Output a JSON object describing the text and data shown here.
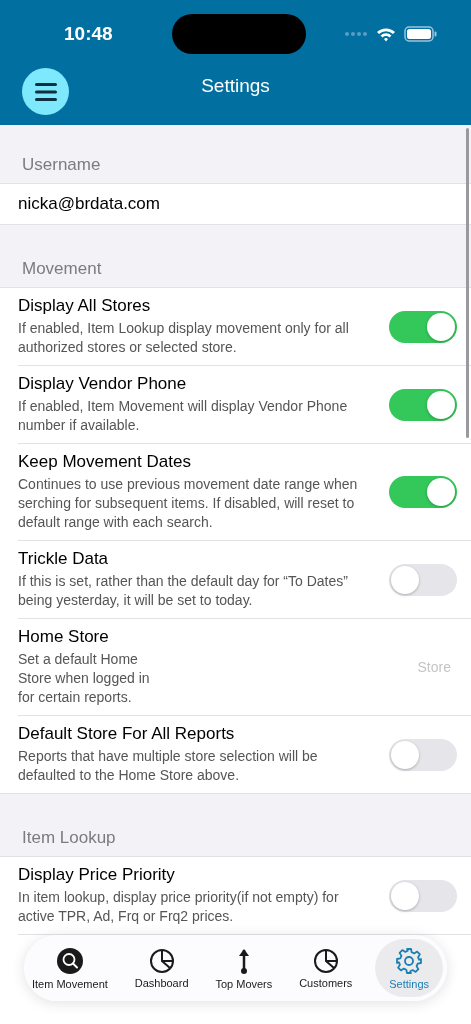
{
  "status_bar": {
    "time": "10:48"
  },
  "nav": {
    "title": "Settings"
  },
  "sections": [
    {
      "header": "Username",
      "rows": [
        {
          "kind": "text",
          "title": "nicka@brdata.com"
        }
      ]
    },
    {
      "header": "Movement",
      "rows": [
        {
          "kind": "toggle",
          "title": "Display All Stores",
          "description": "If enabled, Item Lookup display movement only for all authorized stores or selected store.",
          "on": true
        },
        {
          "kind": "toggle",
          "title": "Display Vendor Phone",
          "description": "If enabled, Item Movement will display Vendor Phone number if available.",
          "on": true
        },
        {
          "kind": "toggle",
          "title": "Keep Movement Dates",
          "description": "Continues to use previous movement date range when serching for subsequent items. If disabled, will reset to default range with each search.",
          "on": true
        },
        {
          "kind": "toggle",
          "title": "Trickle Data",
          "description": "If this is set, rather than the default day for “To Dates” being yesterday, it will be set to today.",
          "on": false
        },
        {
          "kind": "value",
          "title": "Home Store",
          "description": "Set a default Home Store when logged in for certain reports.",
          "placeholder": "Store"
        },
        {
          "kind": "toggle",
          "title": "Default Store For All Reports",
          "description": "Reports that have multiple store selection will be defaulted to the Home Store above.",
          "on": false
        }
      ]
    },
    {
      "header": "Item Lookup",
      "rows": [
        {
          "kind": "toggle",
          "title": "Display Price Priority",
          "description": "In item lookup, display price priority(if not empty) for active TPR, Ad, Frq or Frq2 prices.",
          "on": false
        }
      ]
    }
  ],
  "tab_bar": [
    {
      "label": "Item Movement",
      "selected": false
    },
    {
      "label": "Dashboard",
      "selected": false
    },
    {
      "label": "Top Movers",
      "selected": false
    },
    {
      "label": "Customers",
      "selected": false
    },
    {
      "label": "Settings",
      "selected": true
    }
  ]
}
